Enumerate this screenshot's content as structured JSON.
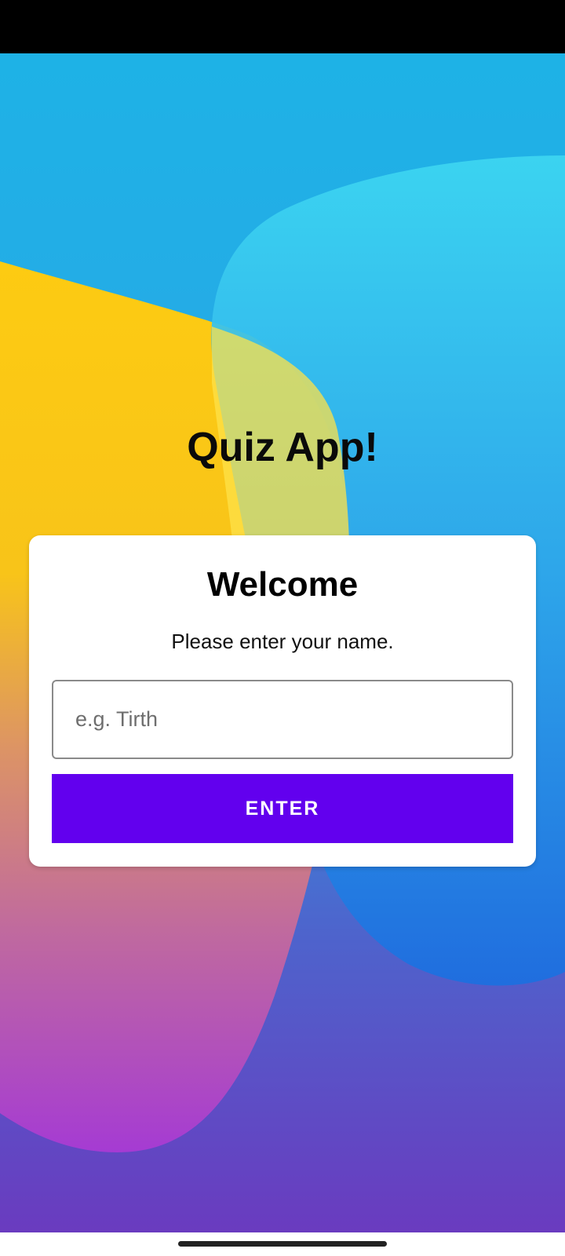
{
  "app": {
    "title": "Quiz App!"
  },
  "card": {
    "title": "Welcome",
    "subtitle": "Please enter your name.",
    "name_input": {
      "value": "",
      "placeholder": "e.g. Tirth"
    },
    "enter_label": "ENTER"
  },
  "colors": {
    "button": "#6200ee",
    "card": "#ffffff",
    "wallpaper_blue": "#1fb3e6",
    "wallpaper_yellow": "#fcc814",
    "wallpaper_purple": "#6a3cc0"
  }
}
